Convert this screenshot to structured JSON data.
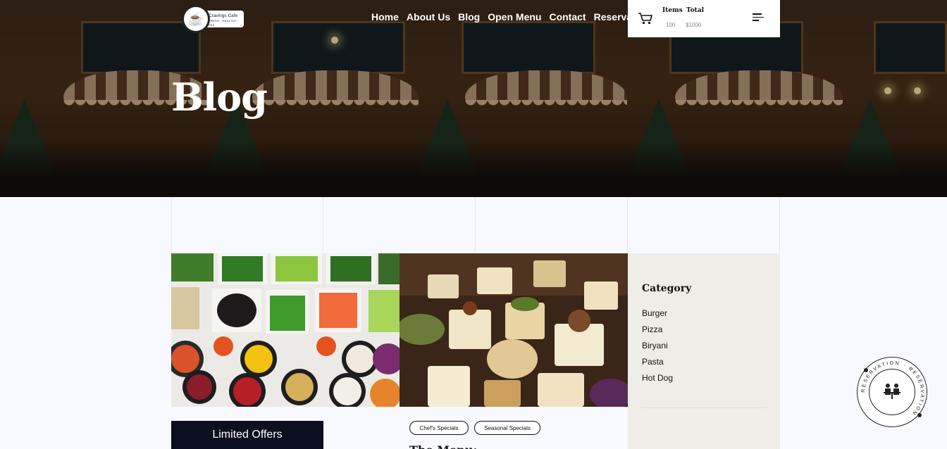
{
  "hero": {
    "title": "Blog"
  },
  "logo": {
    "name": "Cravings Cafe",
    "tagline": "FRESH · HEALTHY · FEE"
  },
  "nav": [
    "Home",
    "About Us",
    "Blog",
    "Open Menu",
    "Contact",
    "Reservation"
  ],
  "cart": {
    "items_label": "Items",
    "total_label": "Total",
    "items_value": "100",
    "total_value": "$1000"
  },
  "sidebar": {
    "heading": "Category",
    "categories": [
      "Burger",
      "Pizza",
      "Biryani",
      "Pasta",
      "Hot Dog"
    ]
  },
  "offer": {
    "label": "Limited Offers"
  },
  "post": {
    "tags": [
      "Chef's Specials",
      "Seasonal Specials"
    ],
    "title": "The Menu: ..."
  },
  "stamp": {
    "text": "RESERVATION · RESERVATION ·"
  }
}
